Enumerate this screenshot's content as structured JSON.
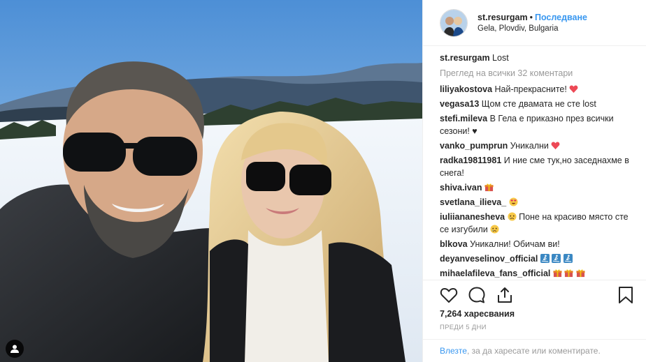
{
  "post": {
    "author": "st.resurgam",
    "separator": "•",
    "follow_label": "Последване",
    "location": "Gela, Plovdiv, Bulgaria",
    "caption_text": "Lost",
    "view_all_comments": "Преглед на всички 32 коментари",
    "comments": [
      {
        "user": "liliyakostova",
        "text": "Най-прекрасните!",
        "emoji": "red-heart"
      },
      {
        "user": "vegasa13",
        "text": "Щом сте двамата не сте lost",
        "emoji": ""
      },
      {
        "user": "stefi.mileva",
        "text": "В Гела е приказно през всички сезони! ♥",
        "emoji": ""
      },
      {
        "user": "vanko_pumprun",
        "text": "Уникални",
        "emoji": "red-heart"
      },
      {
        "user": "radka19811981",
        "text": "И ние сме тук,но заседнахме в снега!",
        "emoji": ""
      },
      {
        "user": "shiva.ivan",
        "text": "",
        "emoji": "gift"
      },
      {
        "user": "svetlana_ilieva_",
        "text": "",
        "emoji": "heart-eyes-face"
      },
      {
        "user": "iuliiananesheva",
        "text": "Поне на красиво място сте се изгубили",
        "emoji": "crying-face"
      },
      {
        "user": "blkova",
        "text": "Уникални! Обичам ви!",
        "emoji": ""
      },
      {
        "user": "deyanveselinov_official",
        "text": "",
        "emoji": "ski-x3"
      },
      {
        "user": "mihaelafileva_fans_official",
        "text": "",
        "emoji": "gift-x3"
      }
    ],
    "likes": "7,264 харесвания",
    "time_ago": "ПРЕДИ 5 ДНИ",
    "login_link": "Влезте",
    "login_text": ", за да харесате или коментирате."
  },
  "icons": {
    "like": "heart-outline-icon",
    "comment": "speech-bubble-icon",
    "share": "share-upload-icon",
    "save": "bookmark-icon",
    "tag": "person-tag-icon"
  },
  "colors": {
    "link": "#3897f0",
    "muted": "#999999",
    "text": "#262626",
    "heart": "#ed4956"
  }
}
